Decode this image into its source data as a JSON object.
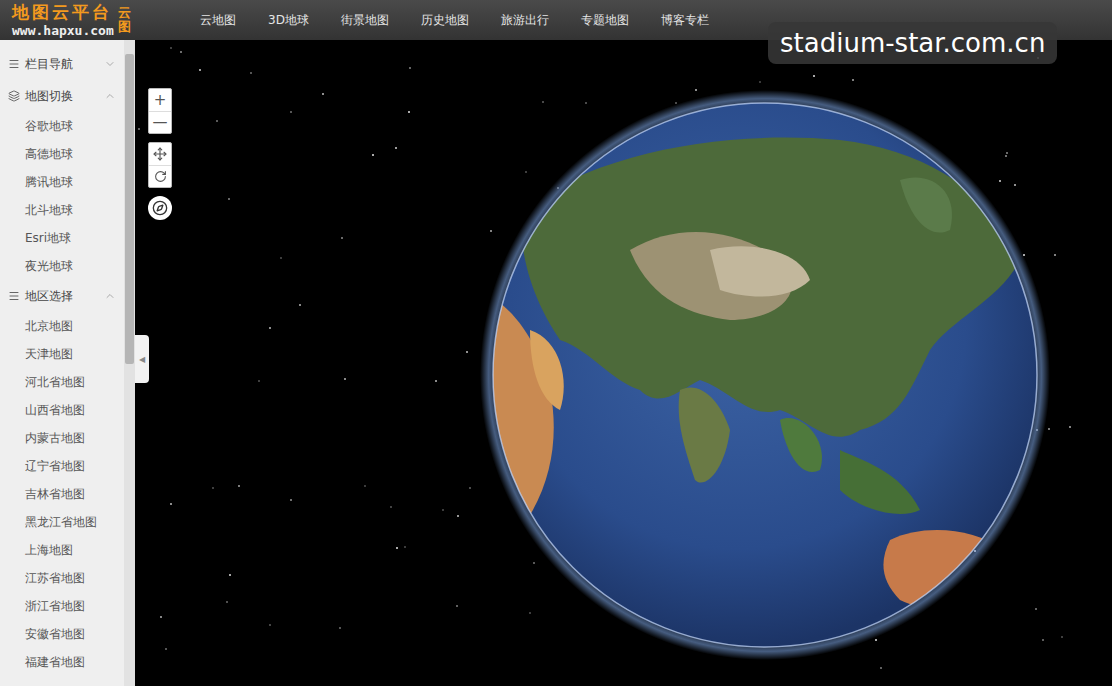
{
  "logo": {
    "title": "地图云平台",
    "url": "www.hapxu.com",
    "badge": "云图"
  },
  "nav": [
    {
      "label": "云地图"
    },
    {
      "label": "3D地球"
    },
    {
      "label": "街景地图"
    },
    {
      "label": "历史地图"
    },
    {
      "label": "旅游出行"
    },
    {
      "label": "专题地图"
    },
    {
      "label": "博客专栏"
    }
  ],
  "watermark": "stadium-star.com.cn",
  "sidebar": {
    "sections": [
      {
        "title": "栏目导航",
        "kind": "nav",
        "expanded": false,
        "items": []
      },
      {
        "title": "地图切换",
        "kind": "layers",
        "expanded": true,
        "items": [
          "谷歌地球",
          "高德地球",
          "腾讯地球",
          "北斗地球",
          "Esri地球",
          "夜光地球"
        ]
      },
      {
        "title": "地区选择",
        "kind": "nav",
        "expanded": true,
        "items": [
          "北京地图",
          "天津地图",
          "河北省地图",
          "山西省地图",
          "内蒙古地图",
          "辽宁省地图",
          "吉林省地图",
          "黑龙江省地图",
          "上海地图",
          "江苏省地图",
          "浙江省地图",
          "安徽省地图",
          "福建省地图"
        ]
      }
    ],
    "collapse_glyph": "◀"
  },
  "map_controls": {
    "zoom_in": "+",
    "zoom_out": "—"
  }
}
